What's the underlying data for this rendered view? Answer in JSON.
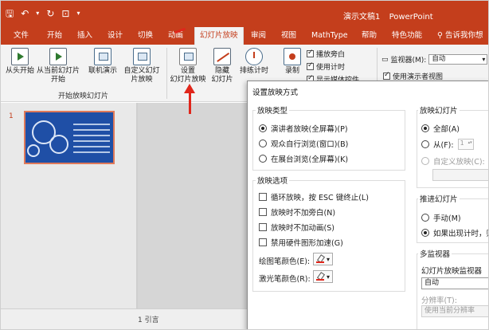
{
  "app": {
    "window_title": "演示文稿1",
    "app_name": "PowerPoint"
  },
  "tabs": [
    {
      "label": "文件"
    },
    {
      "label": "开始"
    },
    {
      "label": "插入"
    },
    {
      "label": "设计"
    },
    {
      "label": "切换"
    },
    {
      "label": "动画"
    },
    {
      "label": "幻灯片放映"
    },
    {
      "label": "审阅"
    },
    {
      "label": "视图"
    },
    {
      "label": "MathType"
    },
    {
      "label": "帮助"
    },
    {
      "label": "特色功能"
    }
  ],
  "tell_me": "告诉我你想",
  "ribbon": {
    "from_start": "从头开始",
    "from_current": "从当前幻灯片开始",
    "online": "联机演示",
    "custom": "自定义幻灯片放映",
    "group_start": "开始放映幻灯片",
    "setup_line1": "设置",
    "setup_line2": "幻灯片放映",
    "hide_line1": "隐藏",
    "hide_line2": "幻灯片",
    "rehearse": "排练计时",
    "record": "录制",
    "check_narration": "播放旁白",
    "check_timing": "使用计时",
    "check_media": "显示媒体控件",
    "monitor_label": "监视器(M):",
    "monitor_value": "自动",
    "presenter_view": "使用演示者视图"
  },
  "slides": [
    {
      "number": "1"
    }
  ],
  "status": "1 引言",
  "dialog": {
    "title": "设置放映方式",
    "show_type": {
      "legend": "放映类型",
      "options": [
        {
          "label": "演讲者放映(全屏幕)(P)",
          "selected": true
        },
        {
          "label": "观众自行浏览(窗口)(B)",
          "selected": false
        },
        {
          "label": "在展台浏览(全屏幕)(K)",
          "selected": false
        }
      ]
    },
    "show_options": {
      "legend": "放映选项",
      "items": [
        {
          "label": "循环放映，按 ESC 键终止(L)"
        },
        {
          "label": "放映时不加旁白(N)"
        },
        {
          "label": "放映时不加动画(S)"
        },
        {
          "label": "禁用硬件图形加速(G)"
        }
      ],
      "pen_color": "绘图笔颜色(E):",
      "laser_color": "激光笔颜色(R):"
    },
    "show_slides": {
      "legend": "放映幻灯片",
      "all": "全部(A)",
      "from": "从(F):",
      "from_value": "1",
      "custom": "自定义放映(C):"
    },
    "advance": {
      "legend": "推进幻灯片",
      "manual": "手动(M)",
      "timings": "如果出现计时，则"
    },
    "multi_monitor": {
      "legend": "多监视器",
      "monitor_label": "幻灯片放映监视器",
      "monitor_value": "自动",
      "resolution_label": "分辨率(T):",
      "resolution_value": "使用当前分辨率"
    }
  },
  "colors": {
    "accent": "#c43e1c",
    "highlight_arrow": "#e0261b",
    "thumb_bg": "#1f4fa6"
  }
}
